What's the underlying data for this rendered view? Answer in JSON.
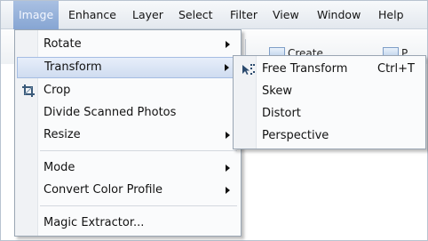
{
  "menubar": {
    "items": [
      "Image",
      "Enhance",
      "Layer",
      "Select",
      "Filter",
      "View",
      "Window",
      "Help"
    ]
  },
  "toolbar": {
    "create_label": "Create",
    "partial_label": "P"
  },
  "image_menu": {
    "items": [
      {
        "label": "Rotate",
        "submenu": true
      },
      {
        "label": "Transform",
        "submenu": true,
        "highlighted": true
      },
      {
        "label": "Crop",
        "icon": "crop-icon"
      },
      {
        "label": "Divide Scanned Photos"
      },
      {
        "label": "Resize",
        "submenu": true
      },
      {
        "label": "Mode",
        "submenu": true
      },
      {
        "label": "Convert Color Profile",
        "submenu": true
      },
      {
        "label": "Magic Extractor..."
      }
    ]
  },
  "transform_submenu": {
    "items": [
      {
        "label": "Free Transform",
        "shortcut": "Ctrl+T",
        "icon": "free-transform-icon"
      },
      {
        "label": "Skew"
      },
      {
        "label": "Distort"
      },
      {
        "label": "Perspective"
      }
    ]
  },
  "colors": {
    "menu_highlight": "#cfdcf0",
    "active_menubar": "#86a5d3"
  }
}
